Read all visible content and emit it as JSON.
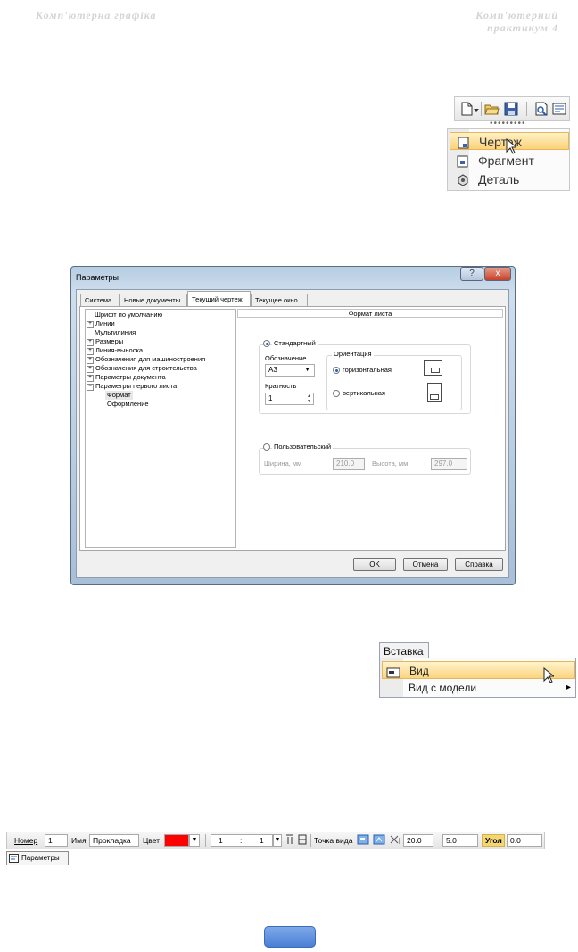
{
  "header": {
    "left": "Комп'ютерна графіка",
    "right_line1": "Комп'ютерний",
    "right_line2": "практикум 4"
  },
  "new_menu": {
    "dots": "•••••••••",
    "items": [
      {
        "label": "Чертеж",
        "icon": "drawing-doc-icon",
        "highlighted": true
      },
      {
        "label": "Фрагмент",
        "icon": "fragment-doc-icon",
        "highlighted": false
      },
      {
        "label": "Деталь",
        "icon": "part-doc-icon",
        "highlighted": false
      }
    ],
    "toolbar_icons": [
      "new-document-icon",
      "open-folder-icon",
      "save-icon",
      "print-preview-icon",
      "properties-icon"
    ]
  },
  "dialog": {
    "title": "Параметры",
    "help_button": "?",
    "close_button": "x",
    "tabs": [
      "Система",
      "Новые документы",
      "Текущий чертеж",
      "Текущее окно"
    ],
    "active_tab": 2,
    "tree": [
      {
        "label": "Шрифт по умолчанию",
        "expander": ""
      },
      {
        "label": "Линии",
        "expander": "+"
      },
      {
        "label": "Мультилиния",
        "expander": ""
      },
      {
        "label": "Размеры",
        "expander": "+"
      },
      {
        "label": "Линия-выноска",
        "expander": "+"
      },
      {
        "label": "Обозначения для машиностроения",
        "expander": "+"
      },
      {
        "label": "Обозначения для строительства",
        "expander": "+"
      },
      {
        "label": "Параметры документа",
        "expander": "+"
      },
      {
        "label": "Параметры первого листа",
        "expander": "−"
      },
      {
        "label": "Формат",
        "expander": ""
      },
      {
        "label": "Оформление",
        "expander": ""
      }
    ],
    "section_title": "Формат листа",
    "standard": {
      "label": "Стандартный",
      "designation_label": "Обозначение",
      "designation_value": "А3",
      "multiplicity_label": "Кратность",
      "multiplicity_value": "1",
      "orientation_label": "Ориентация",
      "horizontal_label": "горизонтальная",
      "vertical_label": "вертикальная"
    },
    "custom": {
      "label": "Пользовательский",
      "width_label": "Ширина, мм",
      "width_value": "210.0",
      "height_label": "Высота, мм",
      "height_value": "297.0"
    },
    "buttons": {
      "ok": "OK",
      "cancel": "Отмена",
      "help": "Справка"
    }
  },
  "insert_menu": {
    "menu_label": "Вставка",
    "items": [
      {
        "label": "Вид",
        "highlighted": true
      },
      {
        "label": "Вид с модели",
        "highlighted": false
      }
    ],
    "submenu_arrow": "▸"
  },
  "property_bar": {
    "number_label": "Номер",
    "number_value": "1",
    "name_label": "Имя",
    "name_value": "Прокладка",
    "color_label": "Цвет",
    "color_value": "#ff0000",
    "scale_left": "1",
    "scale_sep": ":",
    "scale_right": "1",
    "view_point_label": "Точка вида",
    "x_value": "20.0",
    "y_value": "5.0",
    "angle_label": "Угол",
    "angle_value": "0.0",
    "panel_tab": "Параметры"
  }
}
